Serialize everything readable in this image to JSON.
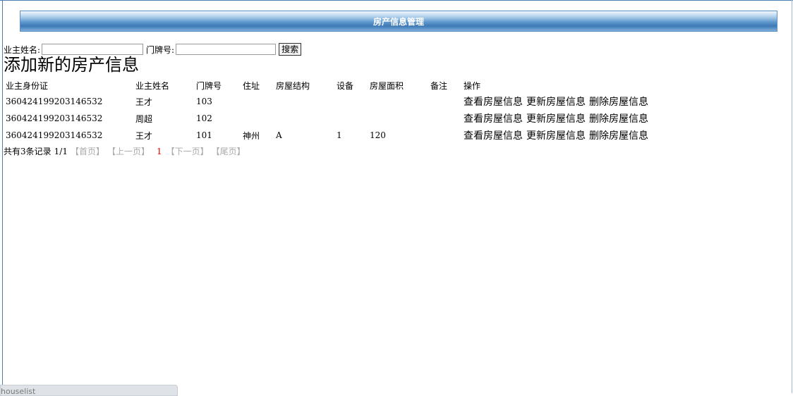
{
  "title": "房产信息管理",
  "search": {
    "owner_name_label": "业主姓名:",
    "owner_name_value": "",
    "door_no_label": "门牌号:",
    "door_no_value": "",
    "button_label": "搜索"
  },
  "add_link": "添加新的房产信息",
  "table": {
    "headers": [
      "业主身份证",
      "业主姓名",
      "门牌号",
      "住址",
      "房屋结构",
      "设备",
      "房屋面积",
      "备注",
      "操作"
    ],
    "rows": [
      {
        "id_card": "360424199203146532",
        "name": "王才",
        "door": "103",
        "address": "",
        "structure": "",
        "equipment": "",
        "area": "",
        "note": ""
      },
      {
        "id_card": "360424199203146532",
        "name": "周超",
        "door": "102",
        "address": "",
        "structure": "",
        "equipment": "",
        "area": "",
        "note": ""
      },
      {
        "id_card": "360424199203146532",
        "name": "王才",
        "door": "101",
        "address": "神州",
        "structure": "A",
        "equipment": "1",
        "area": "120",
        "note": ""
      }
    ],
    "actions": {
      "view": "查看房屋信息",
      "update": "更新房屋信息",
      "delete": "删除房屋信息"
    }
  },
  "pager": {
    "total": "共有3条记录",
    "page": "1/1",
    "first": "【首页】",
    "prev": "【上一页】",
    "current": "1",
    "next": "【下一页】",
    "last": "【尾页】"
  },
  "status_tab": "houselist",
  "colors": {
    "title_bar": "#5d97cd",
    "current_page": "#e00000",
    "disabled_link": "#aaaaaa"
  }
}
